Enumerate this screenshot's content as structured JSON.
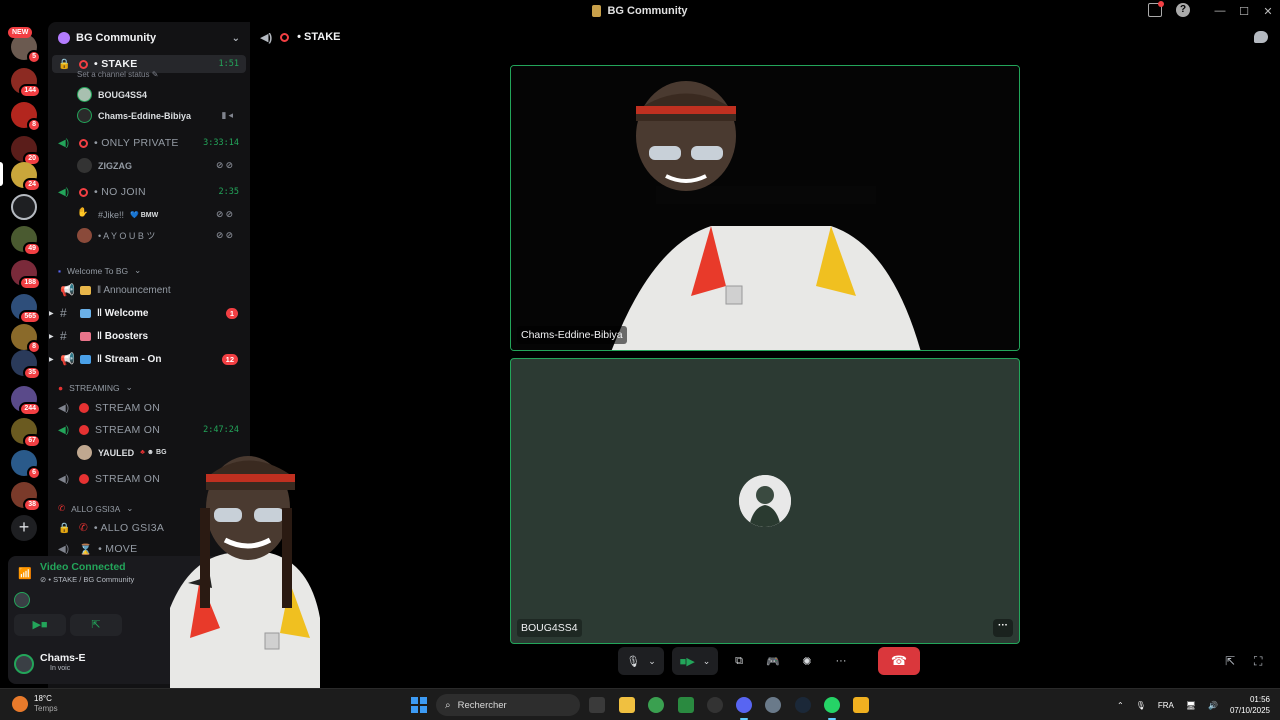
{
  "window": {
    "title": "BG Community"
  },
  "server_rail": {
    "new_label": "NEW",
    "badges": [
      "5",
      "144",
      "8",
      "20",
      "24",
      "49",
      "188",
      "565",
      "8",
      "35",
      "244",
      "67",
      "6",
      "38"
    ]
  },
  "guild": {
    "name": "BG Community"
  },
  "channels": {
    "stake": {
      "name": "STAKE",
      "timer": "1:51",
      "status_hint": "Set a channel status",
      "users": [
        "BOUG4SS4",
        "Chams-Eddine-Bibiya"
      ]
    },
    "only_private": {
      "name": "ONLY PRIVATE",
      "timer": "3:33:14",
      "users": [
        "ZIGZAG"
      ]
    },
    "no_join": {
      "name": "NO JOIN",
      "timer": "2:35",
      "users": [
        "#Jike!!",
        "A Y O U B ツ"
      ],
      "tag": "BMW"
    },
    "welcome_cat": "Welcome To BG",
    "text": [
      {
        "name": "Announcement",
        "bold": false,
        "count": ""
      },
      {
        "name": "Welcome",
        "bold": true,
        "count": "1"
      },
      {
        "name": "Boosters",
        "bold": true,
        "count": ""
      },
      {
        "name": "Stream - On",
        "bold": true,
        "count": "12"
      }
    ],
    "streaming_cat": "STREAMING",
    "streaming": [
      {
        "name": "STREAM ON",
        "timer": ""
      },
      {
        "name": "STREAM ON",
        "timer": "2:47:24"
      },
      {
        "name": "STREAM ON",
        "timer": ""
      }
    ],
    "streaming_user": "YAULED",
    "streaming_user_tag": "BG",
    "allo_cat": "ALLO GSI3A",
    "allo": "ALLO GSI3A",
    "move": "MOVE"
  },
  "voice_panel": {
    "status": "Video Connected",
    "location": "STAKE / BG Community",
    "user": "Chams-E",
    "user_status": "In voic"
  },
  "call": {
    "channel": "STAKE",
    "tiles": [
      {
        "name": "Chams-Eddine-Bibiya"
      },
      {
        "name": "BOUG4SS4"
      }
    ]
  },
  "taskbar": {
    "temp": "18°C",
    "weather": "Temps",
    "search_placeholder": "Rechercher",
    "lang": "FRA",
    "time": "01:56",
    "date": "07/10/2025"
  },
  "colors": {
    "accent_green": "#23a55a",
    "danger_red": "#da373c",
    "sidebar_bg": "#121214"
  }
}
